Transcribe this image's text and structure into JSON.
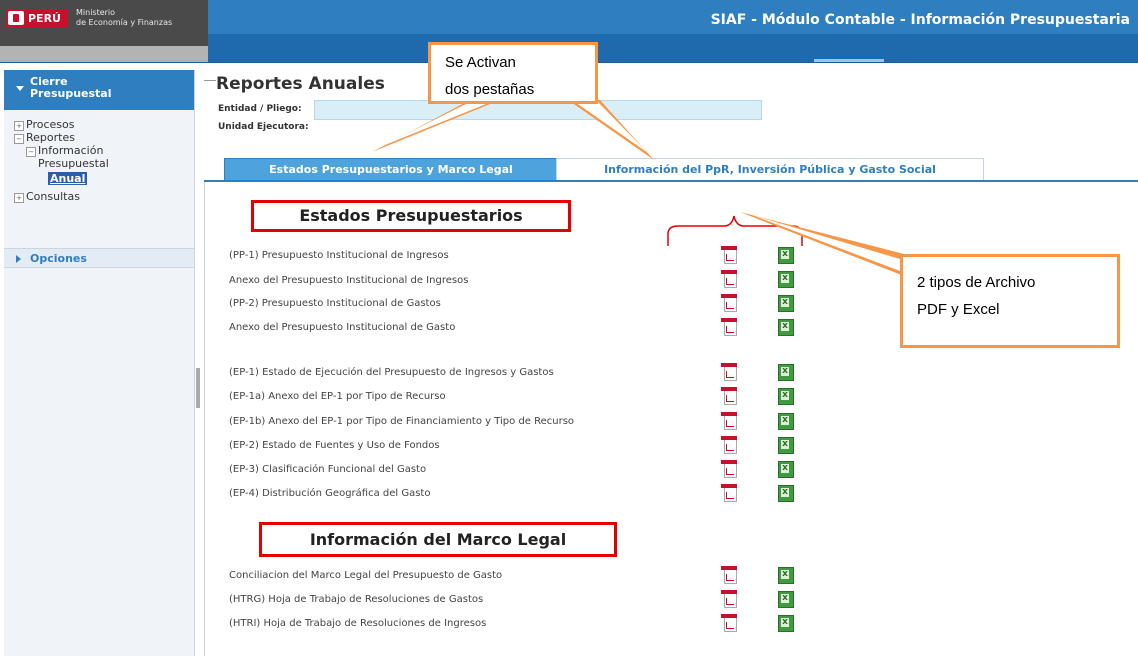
{
  "header": {
    "country": "PERÚ",
    "ministry_line1": "Ministerio",
    "ministry_line2": "de Economía y Finanzas",
    "app_title": "SIAF - Módulo Contable - Información Presupuestaria"
  },
  "sidebar": {
    "section_line1": "Cierre",
    "section_line2": "Presupuestal",
    "tree": {
      "procesos": "Procesos",
      "reportes": "Reportes",
      "info_line1": "Información",
      "info_line2": "Presupuestal",
      "anual": "Anual",
      "consultas": "Consultas"
    },
    "opciones": "Opciones"
  },
  "main": {
    "title": "Reportes Anuales",
    "entidad_label": "Entidad / Pliego:",
    "unidad_label": "Unidad Ejecutora:",
    "tabs": [
      {
        "label": "Estados Presupuestarios y Marco Legal",
        "active": true
      },
      {
        "label": "Información del PpR, Inversión Pública y Gasto Social",
        "active": false
      }
    ],
    "section1_title": "Estados Presupuestarios",
    "section2_title": "Información del Marco Legal",
    "reports": [
      "(PP-1) Presupuesto Institucional de Ingresos",
      "Anexo del Presupuesto Institucional de Ingresos",
      "(PP-2) Presupuesto Institucional de Gastos",
      "Anexo del Presupuesto Institucional de Gasto",
      "(EP-1)  Estado de Ejecución del Presupuesto de Ingresos y Gastos",
      "(EP-1a)  Anexo del EP-1  por Tipo de Recurso",
      "(EP-1b)  Anexo del EP-1 por Tipo de Financiamiento y Tipo de Recurso",
      "(EP-2)  Estado de Fuentes y Uso de Fondos",
      "(EP-3)  Clasificación Funcional del Gasto",
      "(EP-4)  Distribución Geográfica del Gasto",
      "Conciliacion del Marco Legal del Presupuesto de Gasto",
      "(HTRG) Hoja de Trabajo de Resoluciones de Gastos",
      "(HTRI) Hoja de Trabajo de Resoluciones de Ingresos"
    ]
  },
  "callouts": {
    "tabs_line1": "Se Activan",
    "tabs_line2": "dos pestañas",
    "files_line1": "2 tipos de Archivo",
    "files_line2": "PDF y Excel"
  },
  "colors": {
    "header_blue": "#2f7fc0",
    "callout_border": "#f79646",
    "highlight_red": "#e30000",
    "pdf_red": "#c8102e",
    "excel_green": "#3e9b3e"
  },
  "icons": {
    "pdf": "pdf-file-icon",
    "excel": "excel-file-icon"
  }
}
